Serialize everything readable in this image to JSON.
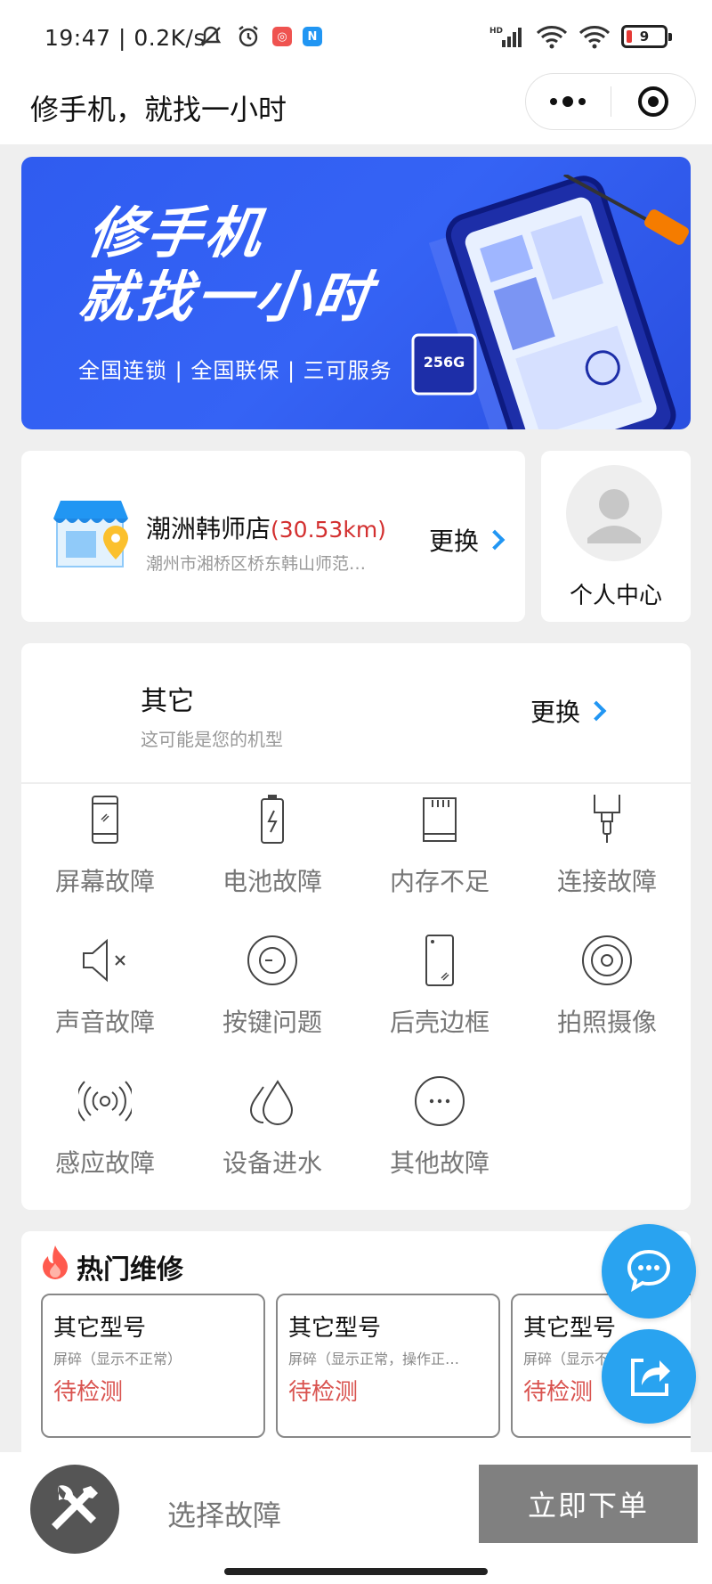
{
  "status_bar": {
    "time": "19:47 | 0.2K/s",
    "battery_level": "9",
    "signal_label": "HD"
  },
  "nav": {
    "title": "修手机，就找一小时"
  },
  "banner": {
    "title_line1": "修手机",
    "title_line2": "就找一小时",
    "subtitle": "全国连锁 | 全国联保 | 三可服务",
    "chip_label": "256G"
  },
  "store": {
    "name": "潮洲韩师店",
    "distance": "(30.53km)",
    "address": "潮州市湘桥区桥东韩山师范…",
    "change_label": "更换"
  },
  "profile": {
    "label": "个人中心"
  },
  "model": {
    "name": "其它",
    "hint": "这可能是您的机型",
    "change_label": "更换"
  },
  "faults": [
    {
      "label": "屏幕故障",
      "icon": "phone-screen-icon"
    },
    {
      "label": "电池故障",
      "icon": "battery-icon"
    },
    {
      "label": "内存不足",
      "icon": "sd-card-icon"
    },
    {
      "label": "连接故障",
      "icon": "connector-icon"
    },
    {
      "label": "声音故障",
      "icon": "speaker-mute-icon"
    },
    {
      "label": "按键问题",
      "icon": "button-icon"
    },
    {
      "label": "后壳边框",
      "icon": "phone-back-icon"
    },
    {
      "label": "拍照摄像",
      "icon": "camera-lens-icon"
    },
    {
      "label": "感应故障",
      "icon": "sensor-icon"
    },
    {
      "label": "设备进水",
      "icon": "water-drop-icon"
    },
    {
      "label": "其他故障",
      "icon": "more-icon"
    }
  ],
  "hot": {
    "title": "热门维修",
    "cards": [
      {
        "model": "其它型号",
        "desc": "屏碎（显示不正常）",
        "status": "待检测"
      },
      {
        "model": "其它型号",
        "desc": "屏碎（显示正常，操作正…",
        "status": "待检测"
      },
      {
        "model": "其它型号",
        "desc": "屏碎（显示不正常）",
        "status": "待检测"
      }
    ]
  },
  "bottom": {
    "select_label": "选择故障",
    "order_label": "立即下单"
  },
  "colors": {
    "accent_blue": "#29a3f0",
    "banner_blue": "#3563f5",
    "distance_red": "#d32f2f",
    "status_red": "#d9534f",
    "order_button_gray": "#808080"
  }
}
